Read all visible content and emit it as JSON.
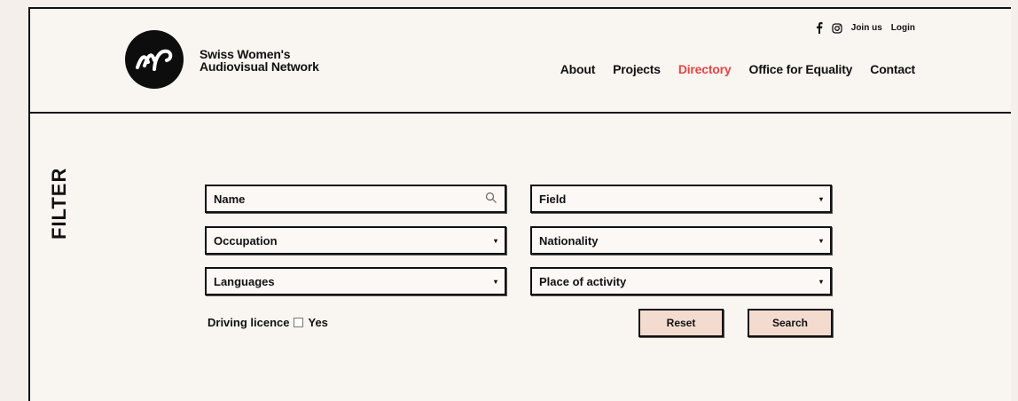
{
  "brand": {
    "line1": "Swiss Women's",
    "line2": "Audiovisual Network"
  },
  "top_links": {
    "facebook_icon": "facebook-icon",
    "instagram_icon": "instagram-icon",
    "join": "Join us",
    "login": "Login"
  },
  "nav": [
    {
      "label": "About",
      "active": false
    },
    {
      "label": "Projects",
      "active": false
    },
    {
      "label": "Directory",
      "active": true
    },
    {
      "label": "Office for Equality",
      "active": false
    },
    {
      "label": "Contact",
      "active": false
    }
  ],
  "colors": {
    "accent": "#e34545",
    "button_bg": "#f3dbcf",
    "page_bg": "#f9f5f1"
  },
  "filter": {
    "title": "FILTER",
    "name_placeholder": "Name",
    "occupation": "Occupation",
    "languages": "Languages",
    "field": "Field",
    "nationality": "Nationality",
    "place": "Place of activity",
    "driving_label": "Driving licence",
    "yes_label": "Yes",
    "reset": "Reset",
    "search": "Search"
  }
}
